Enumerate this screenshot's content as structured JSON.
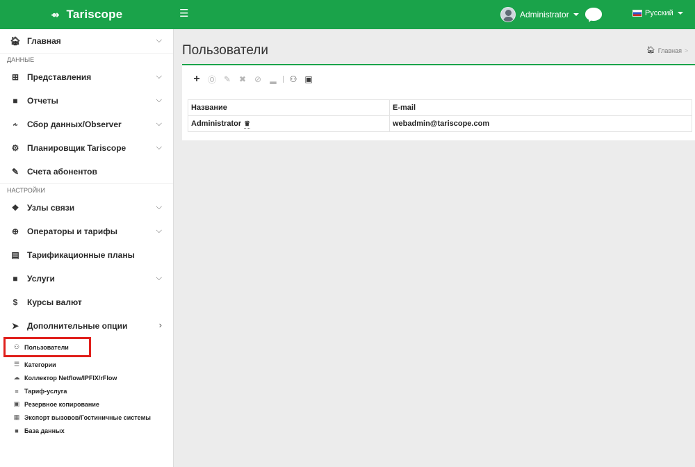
{
  "header": {
    "brand": "Tariscope",
    "brand_icon": "tariscope-logo-icon",
    "menu_icon": "hamburger-icon",
    "user_name": "Administrator",
    "chat_icon": "chat-icon",
    "language": "Русский",
    "accent_color": "#1aa34a"
  },
  "sidebar": {
    "items_top": [
      {
        "label": "Главная",
        "icon": "home-icon",
        "chevron": true
      }
    ],
    "section_data": "ДАННЫЕ",
    "items_data": [
      {
        "label": "Представления",
        "icon": "table-icon",
        "chevron": true
      },
      {
        "label": "Отчеты",
        "icon": "file-icon",
        "chevron": true
      },
      {
        "label": "Сбор данных/Observer",
        "icon": "antenna-icon",
        "chevron": true
      },
      {
        "label": "Планировщик Tariscope",
        "icon": "scheduler-icon",
        "chevron": true
      },
      {
        "label": "Счета абонентов",
        "icon": "invoice-icon",
        "chevron": false
      }
    ],
    "section_settings": "НАСТРОЙКИ",
    "items_settings": [
      {
        "label": "Узлы связи",
        "icon": "nodes-icon",
        "chevron": true
      },
      {
        "label": "Операторы и тарифы",
        "icon": "globe-icon",
        "chevron": true
      },
      {
        "label": "Тарификационные планы",
        "icon": "plans-icon",
        "chevron": false
      },
      {
        "label": "Услуги",
        "icon": "file-icon",
        "chevron": true
      },
      {
        "label": "Курсы валют",
        "icon": "dollar-icon",
        "chevron": false
      },
      {
        "label": "Дополнительные опции",
        "icon": "rocket-icon",
        "chevron": "right"
      }
    ],
    "sub_items": [
      {
        "label": "Пользователи",
        "icon": "users-icon",
        "active": true
      },
      {
        "label": "Категории",
        "icon": "categories-icon"
      },
      {
        "label": "Коллектор Netflow/IPFIX/rFlow",
        "icon": "cloud-icon"
      },
      {
        "label": "Тариф-услуга",
        "icon": "list-icon"
      },
      {
        "label": "Резервное копирование",
        "icon": "backup-icon"
      },
      {
        "label": "Экспорт вызовов/Гостиничные системы",
        "icon": "export-icon"
      },
      {
        "label": "База данных",
        "icon": "database-icon"
      }
    ]
  },
  "main": {
    "title": "Пользователи",
    "breadcrumb_home": "Главная",
    "breadcrumb_sep": ">",
    "toolbar_icons": [
      "add-icon",
      "user-circle-icon",
      "edit-icon",
      "remove-user-icon",
      "block-icon",
      "unlock-icon",
      "separator",
      "user-group-icon",
      "export-icon"
    ],
    "table": {
      "columns": [
        "Название",
        "E-mail"
      ],
      "rows": [
        {
          "name": "Administrator",
          "email": "webadmin@tariscope.com"
        }
      ]
    }
  }
}
